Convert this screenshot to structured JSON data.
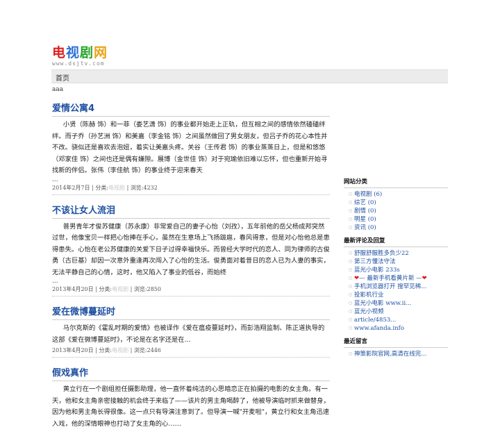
{
  "site": {
    "logo_parts": [
      "电",
      "视",
      "剧",
      "网"
    ],
    "logo_url": "www.dsjtv.com",
    "nav": [
      "首页"
    ],
    "intro": "aaa"
  },
  "posts": [
    {
      "title": "爱情公寓4",
      "excerpt": "小贤（陈赫 饰）和一菲（娄艺潇 饰）的事业都开始走上正轨，但互相之间的感情依然磕磕绊绊。而子乔（孙艺洲 饰）和美嘉（李金铭 饰）之间虽然做回了男女朋友，但吕子乔的花心本性并不改。骁似还是喜欢去泡妞，着实让美嘉头疼。关谷（王传君 饰）的事业蒸蒸日上，但是和悠悠（邓家佳 饰）之间也还是偶有嫌隙。展博（金世佳 饰）对于宛瑜依旧难以忘怀，但也重新开始寻找新的伴侣。张伟（李佳航 饰）的事业终于迎来春天",
      "ellipsis": "...",
      "date": "2014年2月7日",
      "cat_label": "分类:",
      "cat_value": "电视剧",
      "views": "浏览:4232"
    },
    {
      "title": "不该让女人流泪",
      "excerpt": "普男青年才俊苏健康（苏永康）非常爱自己的妻子心怡（刘孜），五年前他的岳父杨成邦突然过世，他像宝贝一样把心怡捧在手心，虽然在生意场上飞扬跋扈，春风得意，但是对心怡他总是患得患失。心怡在老公苏健康的关爱下日子过得幸福快乐。而曾经大学时代的恋人、同为律师的古俊勇（古巨基）却因一次意外重逢再次闯入了心怡的生活。俊勇面对着昔日的恋人已为人妻的事实，无法平静自己的心情，这时，他又陷入了事业的低谷，而始终",
      "ellipsis": "...",
      "date": "2013年4月20日",
      "cat_label": "分类:",
      "cat_value": "电视剧",
      "views": "浏览:2850"
    },
    {
      "title": "爱在微博蔓延时",
      "excerpt": "马尔克斯的《霍乱时期的爱情》也被译作《爱在瘟疫蔓延时》，而彭浩翔监制、陈正道执导的这部《爱在微博蔓延时》，不论是在名字还是在...",
      "ellipsis": "",
      "date": "2013年4月20日",
      "cat_label": "分类:",
      "cat_value": "电视剧",
      "views": "浏览:2446"
    },
    {
      "title": "假戏真作",
      "excerpt": "黄立行在一个剧组担任摄影助理，他一直怀着纯洁的心思暗恋正在拍摄的电影的女主角。有一天，他和女主角亲密接触的机会终于来临了——该片的男主角喝醉了，他被导演临时抓来做替身，因为他和男主角长得很像。这一点只有导演注意到了。但导演一喊\"开麦啦\"，黄立行和女主角迅速入戏，他的深情眼神也打动了女主角的心……",
      "ellipsis": "",
      "date": "",
      "cat_label": "",
      "cat_value": "",
      "views": ""
    }
  ],
  "sidebar": {
    "categories_title": "网站分类",
    "categories": [
      "电视剧 (6)",
      "综艺 (0)",
      "剧情 (0)",
      "明星 (0)",
      "资讯 (0)"
    ],
    "comments_title": "最新评论及回复",
    "comments": [
      "舒服舒服胜多负少22",
      "第三方懂法守法",
      "蓝光小电影 233s",
      "❤— 最新手机看黄片新 —❤",
      "手机浏览器打开 搜罕见稀...",
      "投影机行业",
      "蓝光小电影 www.ii...",
      "蓝光小视频",
      "article/4853...",
      "www.afanda.info"
    ],
    "messages_title": "最近留言",
    "messages": [
      "神策影院官网,高清在线完..."
    ]
  }
}
